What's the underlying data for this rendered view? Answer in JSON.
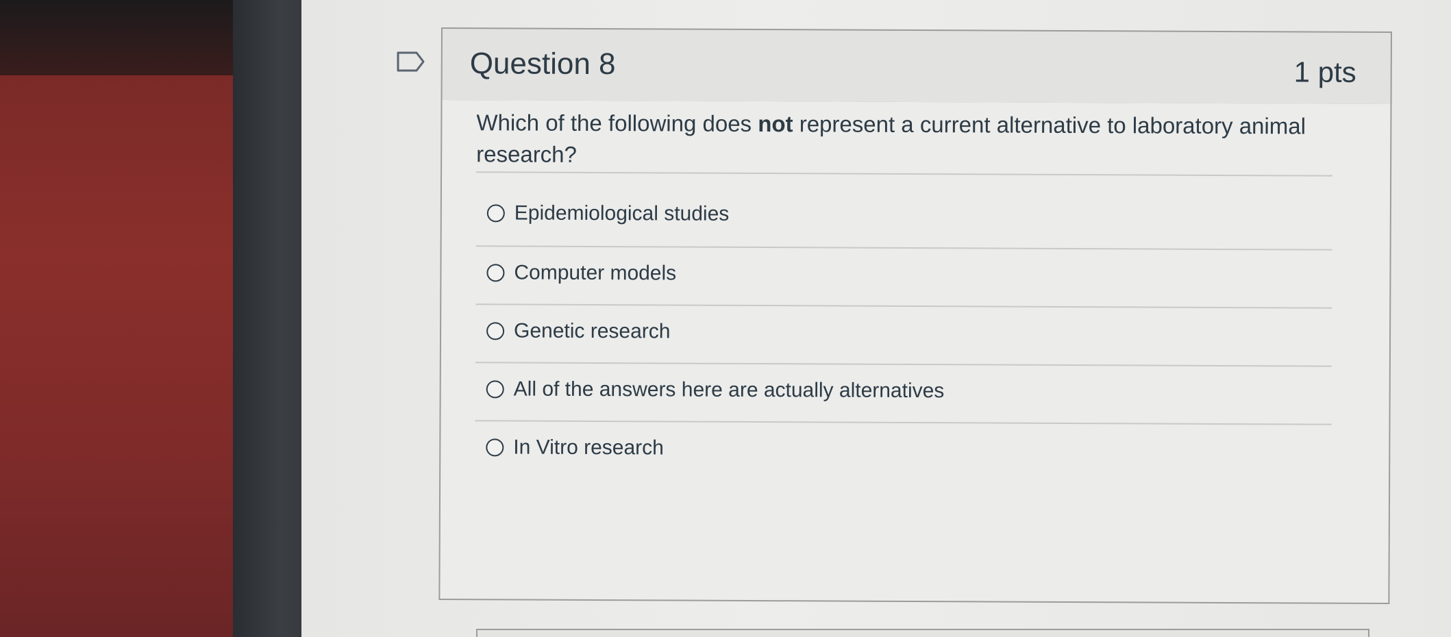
{
  "question": {
    "title": "Question 8",
    "points": "1 pts",
    "prompt_before": "Which of the following does ",
    "prompt_emphasis": "not",
    "prompt_after": " represent a current alternative to laboratory animal research?",
    "flag_icon": "flag-outline-icon",
    "answers": [
      {
        "label": "Epidemiological studies",
        "selected": false
      },
      {
        "label": "Computer models",
        "selected": false
      },
      {
        "label": "Genetic research",
        "selected": false
      },
      {
        "label": "All of the answers here are actually alternatives",
        "selected": false
      },
      {
        "label": "In Vitro research",
        "selected": false
      }
    ]
  },
  "colors": {
    "text": "#2d3b45",
    "header_bg": "#e2e2e1",
    "border": "#9c9c9c"
  }
}
